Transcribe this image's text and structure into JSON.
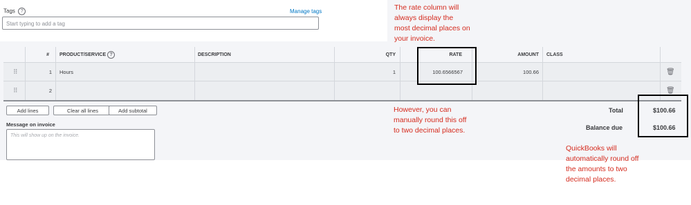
{
  "tags": {
    "label": "Tags",
    "help_icon": "?",
    "manage_link": "Manage tags",
    "placeholder": "Start typing to add a tag"
  },
  "table": {
    "headers": {
      "num": "#",
      "product": "PRODUCT/SERVICE",
      "description": "DESCRIPTION",
      "qty": "QTY",
      "rate": "RATE",
      "amount": "AMOUNT",
      "class": "CLASS"
    },
    "rows": [
      {
        "num": "1",
        "product": "Hours",
        "description": "",
        "qty": "1",
        "rate": "100.6566567",
        "amount": "100.66",
        "class": ""
      },
      {
        "num": "2",
        "product": "",
        "description": "",
        "qty": "",
        "rate": "",
        "amount": "",
        "class": ""
      }
    ],
    "drag_icon": "drag-handle-icon",
    "delete_icon": "trash-icon"
  },
  "buttons": {
    "add_lines": "Add lines",
    "clear_all": "Clear all lines",
    "add_subtotal": "Add subtotal"
  },
  "message": {
    "label": "Message on invoice",
    "placeholder": "This will show up on the invoice."
  },
  "totals": {
    "total_label": "Total",
    "total_value": "$100.66",
    "balance_label": "Balance due",
    "balance_value": "$100.66"
  },
  "annotations": {
    "rate_note": [
      "The rate column will",
      "always display the",
      "most decimal places on",
      "your invoice."
    ],
    "round_note": [
      "However, you can",
      "manually round this off",
      "to two decimal places."
    ],
    "qb_note": [
      "QuickBooks will",
      "automatically round off",
      "the amounts to two",
      "decimal places."
    ]
  },
  "colors": {
    "annotation": "#d52b1e",
    "link": "#0077c5",
    "highlight_box": "#000000"
  }
}
